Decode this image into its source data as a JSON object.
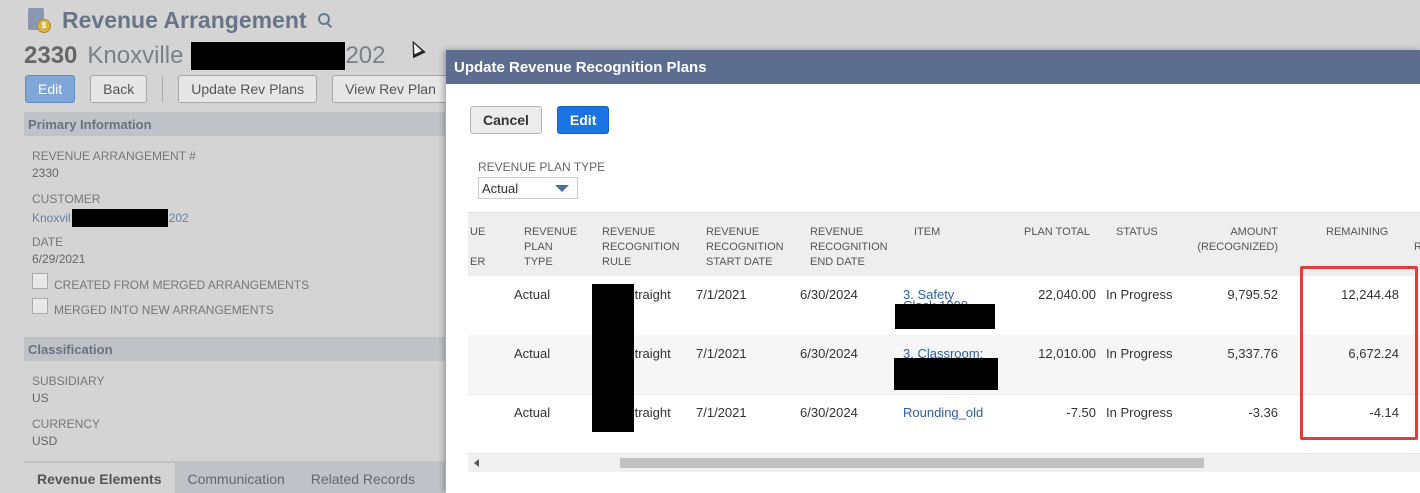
{
  "page": {
    "title": "Revenue Arrangement",
    "record_number": "2330",
    "record_name_start": "Knoxville",
    "record_name_end": "202"
  },
  "toolbar": {
    "edit_label": "Edit",
    "back_label": "Back",
    "update_label": "Update Rev Plans",
    "view_label": "View Rev Plan"
  },
  "primary": {
    "section_title": "Primary Information",
    "arrangement_label": "REVENUE ARRANGEMENT #",
    "arrangement_value": "2330",
    "customer_label": "CUSTOMER",
    "customer_start": "Knoxvil",
    "customer_end": "202",
    "date_label": "DATE",
    "date_value": "6/29/2021",
    "merged_from_label": "CREATED FROM MERGED ARRANGEMENTS",
    "merged_into_label": "MERGED INTO NEW ARRANGEMENTS"
  },
  "classification": {
    "section_title": "Classification",
    "subsidiary_label": "SUBSIDIARY",
    "subsidiary_value": "US",
    "currency_label": "CURRENCY",
    "currency_value": "USD"
  },
  "subtabs": [
    "Revenue Elements",
    "Communication",
    "Related Records"
  ],
  "dialog": {
    "title": "Update Revenue Recognition Plans",
    "cancel_label": "Cancel",
    "edit_label": "Edit",
    "plan_type_label": "REVENUE PLAN TYPE",
    "plan_type_value": "Actual",
    "columns": {
      "col0": "UE",
      "col0b": "ER",
      "plan_type": "REVENUE PLAN TYPE",
      "rule": "REVENUE RECOGNITION RULE",
      "start": "REVENUE RECOGNITION START DATE",
      "end": "REVENUE RECOGNITION END DATE",
      "item": "ITEM",
      "plan_total": "PLAN TOTAL",
      "status": "STATUS",
      "amount": "AMOUNT (RECOGNIZED)",
      "remaining": "REMAINING",
      "extra": "R"
    },
    "rows": [
      {
        "plan_type": "Actual",
        "rule": "y straight",
        "start": "7/1/2021",
        "end": "6/30/2024",
        "item": "3. Safety",
        "item_partial": "Clack 1000",
        "plan_total": "22,040.00",
        "status": "In Progress",
        "amount": "9,795.52",
        "remaining": "12,244.48"
      },
      {
        "plan_type": "Actual",
        "rule": "y straight",
        "start": "7/1/2021",
        "end": "6/30/2024",
        "item": "3. Classroom:",
        "item_partial": "",
        "plan_total": "12,010.00",
        "status": "In Progress",
        "amount": "5,337.76",
        "remaining": "6,672.24"
      },
      {
        "plan_type": "Actual",
        "rule": "y straight",
        "start": "7/1/2021",
        "end": "6/30/2024",
        "item": "Rounding_old",
        "item_partial": "",
        "plan_total": "-7.50",
        "status": "In Progress",
        "amount": "-3.36",
        "remaining": "-4.14"
      }
    ]
  },
  "colors": {
    "dialog_header": "#5c6d90",
    "primary_button": "#1b74e4",
    "highlight_border": "#e23c3c"
  }
}
